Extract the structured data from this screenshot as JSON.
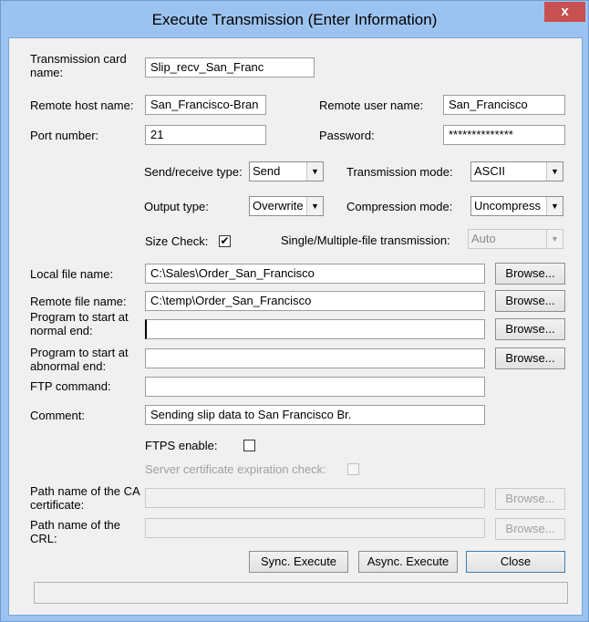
{
  "window": {
    "title": "Execute Transmission (Enter Information)",
    "close_glyph": "x"
  },
  "fields": {
    "card_name": {
      "label": "Transmission card name:",
      "value": "Slip_recv_San_Franc"
    },
    "remote_host": {
      "label": "Remote host name:",
      "value": "San_Francisco-Bran"
    },
    "remote_user": {
      "label": "Remote user name:",
      "value": "San_Francisco"
    },
    "port": {
      "label": "Port number:",
      "value": "21"
    },
    "password": {
      "label": "Password:",
      "value": "**************"
    },
    "local_file": {
      "label": "Local file name:",
      "value": "C:\\Sales\\Order_San_Francisco"
    },
    "remote_file": {
      "label": "Remote file name:",
      "value": "C:\\temp\\Order_San_Francisco"
    },
    "program_normal": {
      "label": "Program to start at normal end:",
      "value": ""
    },
    "program_abnormal": {
      "label": "Program to start at abnormal end:",
      "value": ""
    },
    "ftp_command": {
      "label": "FTP command:",
      "value": ""
    },
    "comment": {
      "label": "Comment:",
      "value": "Sending slip data to San Francisco Br."
    },
    "ca_cert": {
      "label": "Path name of the CA certificate:",
      "value": ""
    },
    "crl": {
      "label": "Path name of the CRL:",
      "value": ""
    }
  },
  "options": {
    "send_receive_type": {
      "label": "Send/receive type:",
      "value": "Send"
    },
    "transmission_mode": {
      "label": "Transmission mode:",
      "value": "ASCII"
    },
    "output_type": {
      "label": "Output type:",
      "value": "Overwrite"
    },
    "compression_mode": {
      "label": "Compression mode:",
      "value": "Uncompress"
    },
    "size_check": {
      "label": "Size Check:",
      "checked": true
    },
    "single_multiple": {
      "label": "Single/Multiple-file transmission:",
      "value": "Auto"
    },
    "ftps_enable": {
      "label": "FTPS enable:",
      "checked": false
    },
    "server_cert_check": {
      "label": "Server certificate expiration check:",
      "checked": false
    }
  },
  "buttons": {
    "browse": "Browse...",
    "sync_execute": "Sync. Execute",
    "async_execute": "Async. Execute",
    "close": "Close"
  },
  "icons": {
    "dropdown": "▼",
    "check": "✔"
  },
  "colors": {
    "frame": "#9cc3ef",
    "close_button": "#c75050",
    "client": "#f0f0f0"
  }
}
